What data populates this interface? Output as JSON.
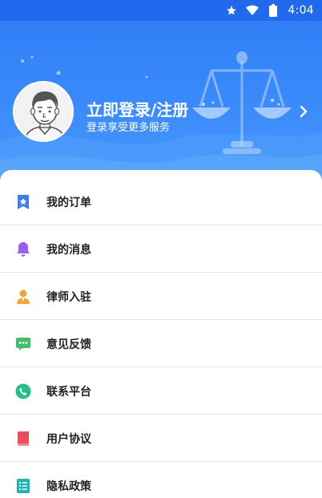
{
  "status_bar": {
    "time": "4:04"
  },
  "profile": {
    "title": "立即登录/注册",
    "subtitle": "登录享受更多服务"
  },
  "menu": [
    {
      "label": "我的订单",
      "icon": "bookmark-star-icon",
      "color": "#3d7cf0"
    },
    {
      "label": "我的消息",
      "icon": "bell-icon",
      "color": "#9b5cf0"
    },
    {
      "label": "律师入驻",
      "icon": "lawyer-person-icon",
      "color": "#f2a33a"
    },
    {
      "label": "意见反馈",
      "icon": "chat-bubble-icon",
      "color": "#3fbf6a"
    },
    {
      "label": "联系平台",
      "icon": "phone-icon",
      "color": "#22c08a"
    },
    {
      "label": "用户协议",
      "icon": "book-icon",
      "color": "#ec4d5e"
    },
    {
      "label": "隐私政策",
      "icon": "list-icon",
      "color": "#22b3b0"
    }
  ],
  "colors": {
    "header_top": "#2f7cf6",
    "header_bottom": "#4d9cfb"
  }
}
